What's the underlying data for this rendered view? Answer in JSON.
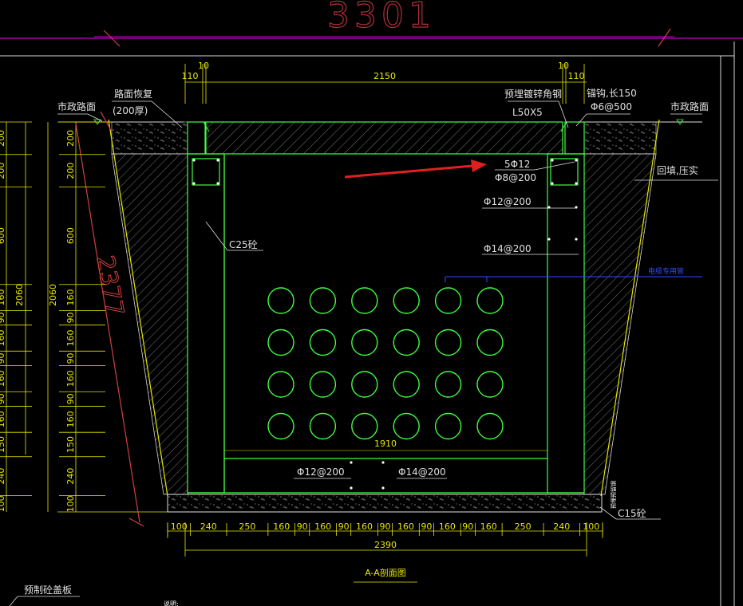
{
  "drawing": {
    "title_number": "3301",
    "section_title": "A-A剖面图",
    "labels": {
      "road_restore": "路面恢复",
      "road_restore_thickness": "(200厚)",
      "city_road_left": "市政路面",
      "city_road_right": "市政路面",
      "embedded_angle": "预埋镀锌角钢",
      "angle_size": "L50X5",
      "anchor_hook": "锚钩,长150",
      "anchor_spacing": "Φ6@500",
      "rebar_top": "5Φ12",
      "rebar_top_stirrup": "Φ8@200",
      "rebar_wall_1": "Φ12@200",
      "rebar_wall_2": "Φ14@200",
      "concrete_c25": "C25砼",
      "backfill": "回填,压实",
      "cable_tube": "电缆专用管",
      "rebar_bottom_1": "Φ12@200",
      "rebar_bottom_2": "Φ14@200",
      "concrete_c15": "C15砼",
      "cushion_note": "预埋预留钢",
      "precast_cover": "预制砼盖板",
      "note": "说明:"
    },
    "dims_top": [
      "110",
      "10",
      "2150",
      "10",
      "110"
    ],
    "dims_bottom": [
      "100",
      "240",
      "250",
      "160",
      "90",
      "160",
      "90",
      "160",
      "90",
      "160",
      "90",
      "160",
      "90",
      "160",
      "250",
      "240",
      "100"
    ],
    "dim_total_bottom": "2390",
    "dim_inner_bottom": "1910",
    "dims_left": [
      "200",
      "200",
      "600",
      "160",
      "90",
      "160",
      "90",
      "160",
      "90",
      "160",
      "150",
      "240",
      "100"
    ],
    "dim_height_total": "2060",
    "dim_height_total_far": "2060",
    "dim_slope": "2377",
    "dims_far_left": [
      "200",
      "200",
      "600",
      "160",
      "90",
      "160",
      "90",
      "160",
      "90",
      "160",
      "150",
      "240",
      "100"
    ],
    "pipe_grid": {
      "rows": 4,
      "cols": 6
    }
  }
}
